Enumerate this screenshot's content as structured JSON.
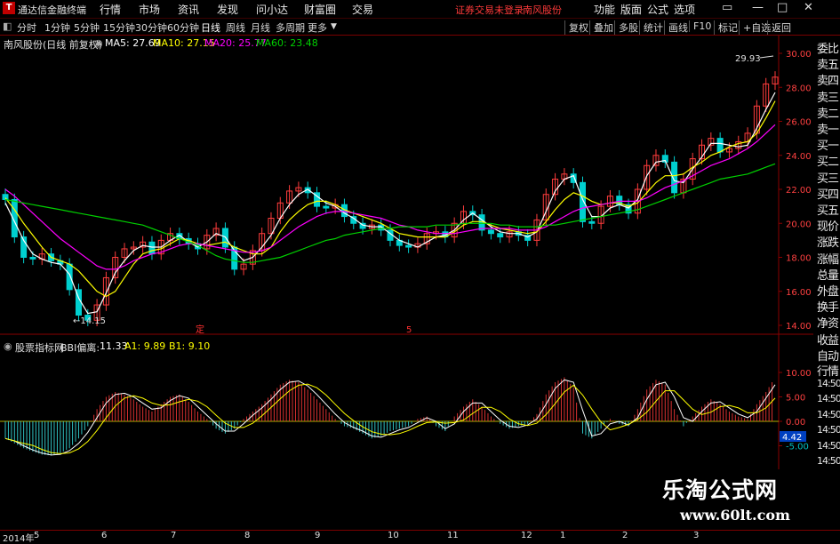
{
  "titlebar": {
    "app_name": "通达信金融终端",
    "menu": [
      "行情",
      "市场",
      "资讯",
      "发现",
      "问小达",
      "财富圈",
      "交易"
    ],
    "warning": "证券交易未登录",
    "stock": "南风股份",
    "right_menu": [
      "功能",
      "版面",
      "公式",
      "选项"
    ],
    "window_buttons": [
      "▭",
      "—",
      "□",
      "✕"
    ]
  },
  "periodbar": {
    "periods": [
      "分时",
      "1分钟",
      "5分钟",
      "15分钟",
      "30分钟",
      "60分钟",
      "日线",
      "周线",
      "月线",
      "多周期",
      "更多"
    ],
    "active": "日线",
    "tools": [
      "复权",
      "叠加",
      "多股",
      "统计",
      "画线",
      "F10",
      "标记",
      "+自选",
      "返回"
    ]
  },
  "main_legend": {
    "title": "南风股份(日线 前复权)",
    "ma5": "MA5: 27.69",
    "ma10": "MA10: 27.15",
    "ma20": "MA20: 25.77",
    "ma60": "MA60: 23.48",
    "colors": {
      "ma5": "#ffffff",
      "ma10": "#ffff00",
      "ma20": "#ff00ff",
      "ma60": "#00d000"
    }
  },
  "sub_legend": {
    "title": "股票指标网",
    "indicator": "BBI偏离:",
    "v1": "11.33",
    "a1": "A1: 9.89",
    "b1": "B1: 9.10"
  },
  "annotations": {
    "high": "29.93",
    "low": "14.15",
    "marker1": "定",
    "marker2": "5"
  },
  "right_panel": [
    "委比",
    "卖五",
    "卖四",
    "卖三",
    "卖二",
    "卖一",
    "买一",
    "买二",
    "买三",
    "买四",
    "买五",
    "现价",
    "涨跌",
    "涨幅",
    "总量",
    "外盘",
    "换手",
    "净资",
    "收益",
    "自动",
    "行情",
    "14:50",
    "14:50",
    "14:50",
    "14:50",
    "14:50",
    "14:50",
    "14:50"
  ],
  "xaxis_labels": [
    "2014年",
    "5",
    "6",
    "7",
    "8",
    "9",
    "10",
    "11",
    "12",
    "1",
    "2",
    "3"
  ],
  "watermark": {
    "line1": "乐淘公式网",
    "line2": "www.60lt.com"
  },
  "chart_data": [
    {
      "type": "candlestick",
      "title": "南风股份(日线 前复权)",
      "ylim": [
        13.5,
        31
      ],
      "yticks": [
        "30.00",
        "28.00",
        "26.00",
        "24.00",
        "22.00",
        "20.00",
        "18.00",
        "16.00",
        "14.00"
      ],
      "series": [
        {
          "name": "MA5",
          "values": [
            21.2,
            20.1,
            19.0,
            18.2,
            17.9,
            17.7,
            17.6,
            17.0,
            15.6,
            14.7,
            14.8,
            15.9,
            17.1,
            17.8,
            18.4,
            18.7,
            18.6,
            18.6,
            19.0,
            19.3,
            18.9,
            18.6,
            18.9,
            19.4,
            19.2,
            18.4,
            17.8,
            18.0,
            18.6,
            19.3,
            20.3,
            21.1,
            21.7,
            22.0,
            21.6,
            21.2,
            21.0,
            20.6,
            20.3,
            19.9,
            19.8,
            19.8,
            19.4,
            19.0,
            18.8,
            18.6,
            18.9,
            19.2,
            19.3,
            19.6,
            20.2,
            20.6,
            20.2,
            19.8,
            19.5,
            19.4,
            19.4,
            19.2,
            19.5,
            20.7,
            21.9,
            22.6,
            22.8,
            21.4,
            20.4,
            20.4,
            20.9,
            21.1,
            20.9,
            21.4,
            22.8,
            23.6,
            23.7,
            22.5,
            22.4,
            23.2,
            23.9,
            24.7,
            24.7,
            24.6,
            24.5,
            24.6,
            25.6,
            26.7,
            27.7
          ]
        },
        {
          "name": "MA10",
          "values": [
            21.5,
            20.8,
            20.0,
            19.3,
            18.6,
            18.0,
            17.8,
            17.6,
            17.2,
            16.6,
            16.0,
            15.7,
            16.0,
            16.8,
            17.6,
            18.2,
            18.4,
            18.5,
            18.8,
            19.1,
            19.0,
            18.8,
            18.7,
            18.8,
            18.9,
            18.6,
            18.4,
            18.2,
            18.2,
            18.6,
            19.5,
            20.2,
            20.7,
            21.1,
            21.3,
            21.3,
            21.1,
            20.8,
            20.6,
            20.4,
            20.2,
            20.0,
            19.7,
            19.4,
            19.3,
            19.2,
            19.2,
            19.2,
            19.2,
            19.5,
            19.9,
            20.1,
            20.1,
            19.9,
            19.7,
            19.6,
            19.5,
            19.4,
            19.5,
            20.1,
            20.8,
            21.4,
            21.8,
            21.6,
            21.3,
            21.1,
            21.2,
            21.2,
            21.0,
            21.2,
            21.8,
            22.4,
            22.8,
            22.8,
            22.9,
            23.3,
            23.6,
            24.0,
            24.2,
            24.5,
            24.7,
            24.8,
            25.3,
            26.2,
            27.2
          ]
        },
        {
          "name": "MA20",
          "values": [
            22.0,
            21.6,
            21.1,
            20.6,
            20.1,
            19.6,
            19.1,
            18.7,
            18.3,
            17.9,
            17.5,
            17.3,
            17.3,
            17.5,
            17.8,
            18.0,
            18.2,
            18.3,
            18.5,
            18.7,
            18.8,
            18.8,
            18.7,
            18.6,
            18.5,
            18.4,
            18.3,
            18.3,
            18.4,
            18.6,
            19.0,
            19.4,
            19.8,
            20.1,
            20.4,
            20.6,
            20.7,
            20.7,
            20.6,
            20.5,
            20.4,
            20.3,
            20.1,
            19.9,
            19.8,
            19.6,
            19.5,
            19.4,
            19.4,
            19.4,
            19.5,
            19.6,
            19.7,
            19.7,
            19.7,
            19.7,
            19.6,
            19.6,
            19.6,
            19.8,
            20.1,
            20.4,
            20.7,
            20.9,
            21.0,
            21.1,
            21.2,
            21.3,
            21.3,
            21.3,
            21.5,
            21.8,
            22.1,
            22.3,
            22.5,
            22.8,
            23.1,
            23.4,
            23.6,
            23.8,
            24.1,
            24.4,
            24.8,
            25.3,
            25.8
          ]
        },
        {
          "name": "MA60",
          "values": [
            21.4,
            21.3,
            21.2,
            21.1,
            21.0,
            20.9,
            20.8,
            20.7,
            20.6,
            20.5,
            20.4,
            20.3,
            20.2,
            20.1,
            20.0,
            19.9,
            19.7,
            19.5,
            19.3,
            19.1,
            18.9,
            18.7,
            18.4,
            18.1,
            17.9,
            17.8,
            17.7,
            17.7,
            17.8,
            17.9,
            18.0,
            18.2,
            18.4,
            18.6,
            18.8,
            19.0,
            19.1,
            19.3,
            19.4,
            19.5,
            19.6,
            19.7,
            19.7,
            19.8,
            19.8,
            19.8,
            19.8,
            19.9,
            19.9,
            19.9,
            20.0,
            20.0,
            20.0,
            20.0,
            19.9,
            19.9,
            19.8,
            19.8,
            19.8,
            19.9,
            19.9,
            20.0,
            20.1,
            20.2,
            20.3,
            20.4,
            20.5,
            20.6,
            20.7,
            20.8,
            21.0,
            21.2,
            21.4,
            21.6,
            21.8,
            22.0,
            22.2,
            22.4,
            22.6,
            22.7,
            22.8,
            22.9,
            23.1,
            23.3,
            23.5
          ]
        }
      ],
      "closes": [
        21.4,
        19.2,
        18.0,
        17.9,
        18.2,
        17.8,
        17.6,
        16.1,
        14.6,
        14.3,
        15.2,
        16.8,
        18.0,
        18.5,
        18.6,
        18.9,
        18.2,
        19.0,
        19.4,
        19.1,
        18.8,
        18.5,
        19.3,
        19.7,
        18.6,
        17.3,
        17.6,
        18.4,
        19.4,
        20.3,
        21.2,
        21.9,
        22.1,
        21.8,
        21.0,
        20.9,
        21.1,
        20.4,
        20.0,
        19.7,
        19.9,
        19.6,
        19.0,
        18.7,
        18.6,
        18.8,
        19.4,
        19.5,
        19.2,
        20.0,
        20.7,
        20.5,
        19.6,
        19.4,
        19.2,
        19.5,
        19.3,
        19.0,
        20.2,
        21.7,
        22.6,
        22.9,
        22.4,
        20.1,
        20.0,
        21.0,
        21.6,
        21.1,
        20.6,
        22.0,
        23.4,
        24.0,
        23.6,
        21.8,
        22.6,
        23.8,
        24.6,
        25.0,
        24.2,
        24.4,
        24.8,
        25.3,
        26.9,
        28.2,
        28.6
      ],
      "ma5_last": 27.69,
      "ma10_last": 27.15,
      "ma20_last": 25.77,
      "ma60_last": 23.48,
      "high": 29.93,
      "low": 14.15
    },
    {
      "type": "bar",
      "title": "BBI偏离",
      "ylim": [
        -7,
        12
      ],
      "yticks": [
        "10.00",
        "5.00",
        "0.00",
        "-5.00"
      ],
      "last_values": {
        "BBI偏离": 11.33,
        "A1": 9.89,
        "B1": 9.1
      },
      "current_value_label": "4.42",
      "values": [
        -3.5,
        -4.5,
        -5.5,
        -6.2,
        -6.8,
        -7.0,
        -6.5,
        -5.5,
        -3.5,
        -1.0,
        2.5,
        5.0,
        6.0,
        5.5,
        4.5,
        3.0,
        2.0,
        3.5,
        5.0,
        5.5,
        4.0,
        2.0,
        0.5,
        -1.5,
        -2.5,
        -1.5,
        0.5,
        2.0,
        3.5,
        5.5,
        7.5,
        8.5,
        8.0,
        6.5,
        4.5,
        2.5,
        0.5,
        -1.0,
        -1.5,
        -2.5,
        -3.5,
        -3.0,
        -2.0,
        -1.5,
        -1.0,
        0.5,
        1.0,
        -1.0,
        -2.0,
        1.0,
        3.0,
        4.5,
        3.0,
        1.0,
        -0.5,
        -1.5,
        -1.0,
        -0.5,
        1.5,
        5.5,
        8.0,
        9.0,
        7.0,
        -2.5,
        -3.5,
        -1.5,
        0.5,
        -0.5,
        -1.0,
        2.5,
        6.5,
        8.5,
        7.5,
        2.5,
        -1.0,
        1.0,
        3.0,
        4.5,
        3.5,
        2.0,
        1.0,
        0.5,
        3.5,
        6.0,
        9.0
      ]
    }
  ]
}
